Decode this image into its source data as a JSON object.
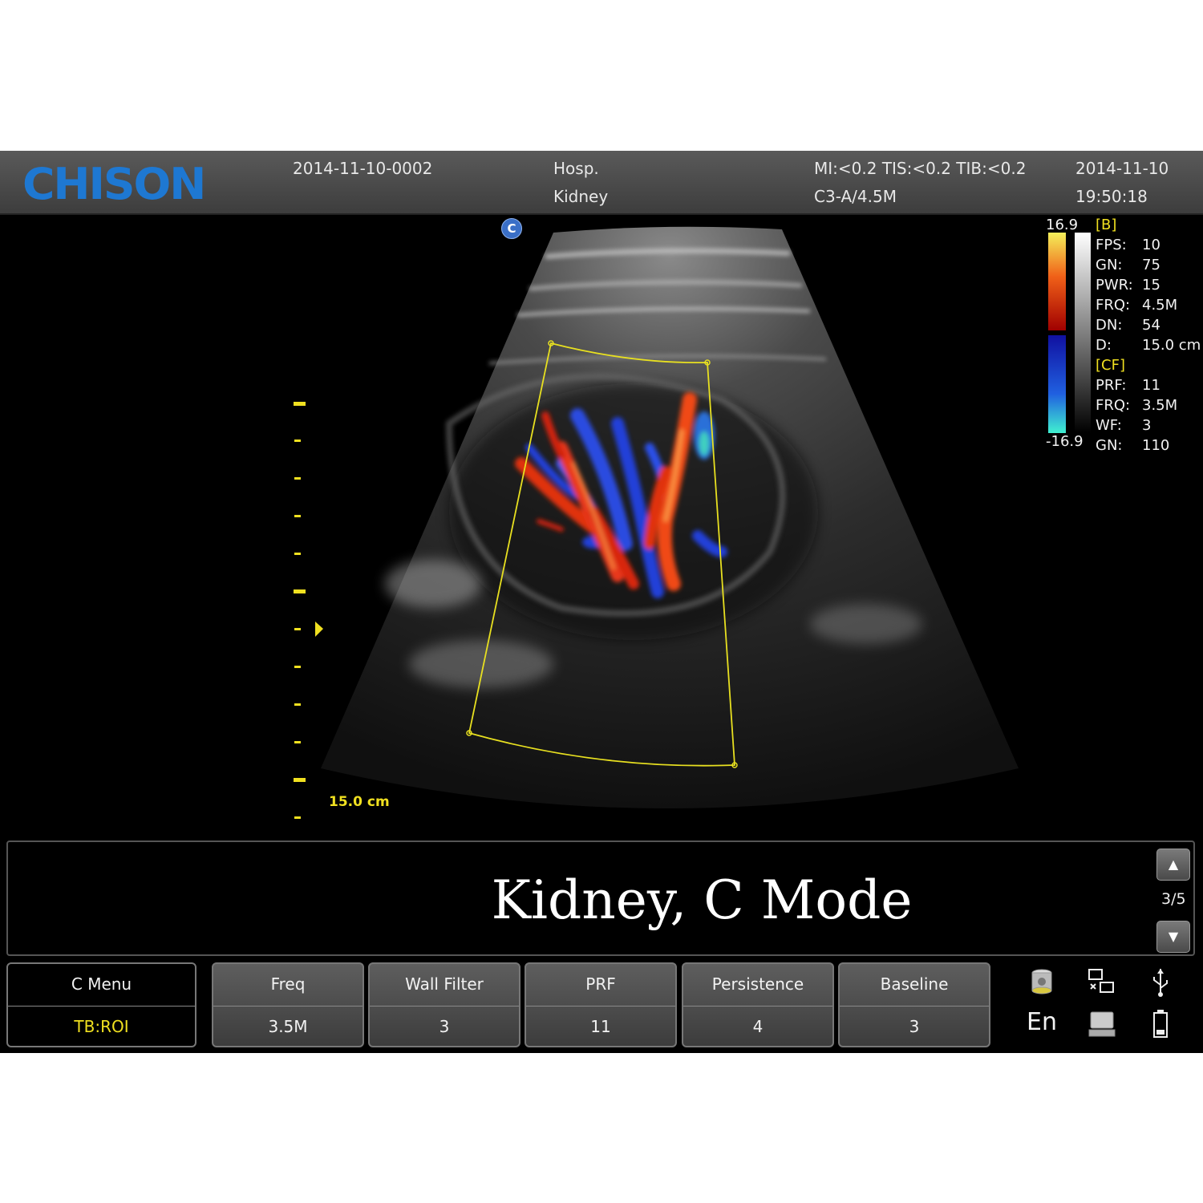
{
  "header": {
    "logo": "CHISON",
    "patient_id": "2014-11-10-0002",
    "hospital": "Hosp.",
    "exam": "Kidney",
    "safety_indices": "MI:<0.2  TIS:<0.2  TIB:<0.2",
    "probe": "C3-A/4.5M",
    "date": "2014-11-10",
    "time": "19:50:18"
  },
  "image": {
    "mode_badge": "C",
    "depth_label": "15.0 cm",
    "color_scale": {
      "max": "16.9",
      "min": "-16.9"
    }
  },
  "params": {
    "b_header": "[B]",
    "b": [
      {
        "label": "FPS:",
        "value": "10"
      },
      {
        "label": "GN:",
        "value": "75"
      },
      {
        "label": "PWR:",
        "value": "15"
      },
      {
        "label": "FRQ:",
        "value": "4.5M"
      },
      {
        "label": "DN:",
        "value": "54"
      },
      {
        "label": "D:",
        "value": "15.0 cm"
      }
    ],
    "cf_header": "[CF]",
    "cf": [
      {
        "label": "PRF:",
        "value": "11"
      },
      {
        "label": "FRQ:",
        "value": "3.5M"
      },
      {
        "label": "WF:",
        "value": "3"
      },
      {
        "label": "GN:",
        "value": "110"
      }
    ]
  },
  "caption": {
    "text": "Kidney, C Mode",
    "page": "3/5"
  },
  "menu": {
    "title": "C Menu",
    "trackball": "TB:ROI",
    "buttons": [
      {
        "label": "Freq",
        "value": "3.5M"
      },
      {
        "label": "Wall Filter",
        "value": "3"
      },
      {
        "label": "PRF",
        "value": "11"
      },
      {
        "label": "Persistence",
        "value": "4"
      },
      {
        "label": "Baseline",
        "value": "3"
      }
    ]
  },
  "status": {
    "language": "En"
  },
  "colors": {
    "brand": "#1e78d2",
    "annotation": "#f0e020",
    "roi": "#e8e020"
  }
}
